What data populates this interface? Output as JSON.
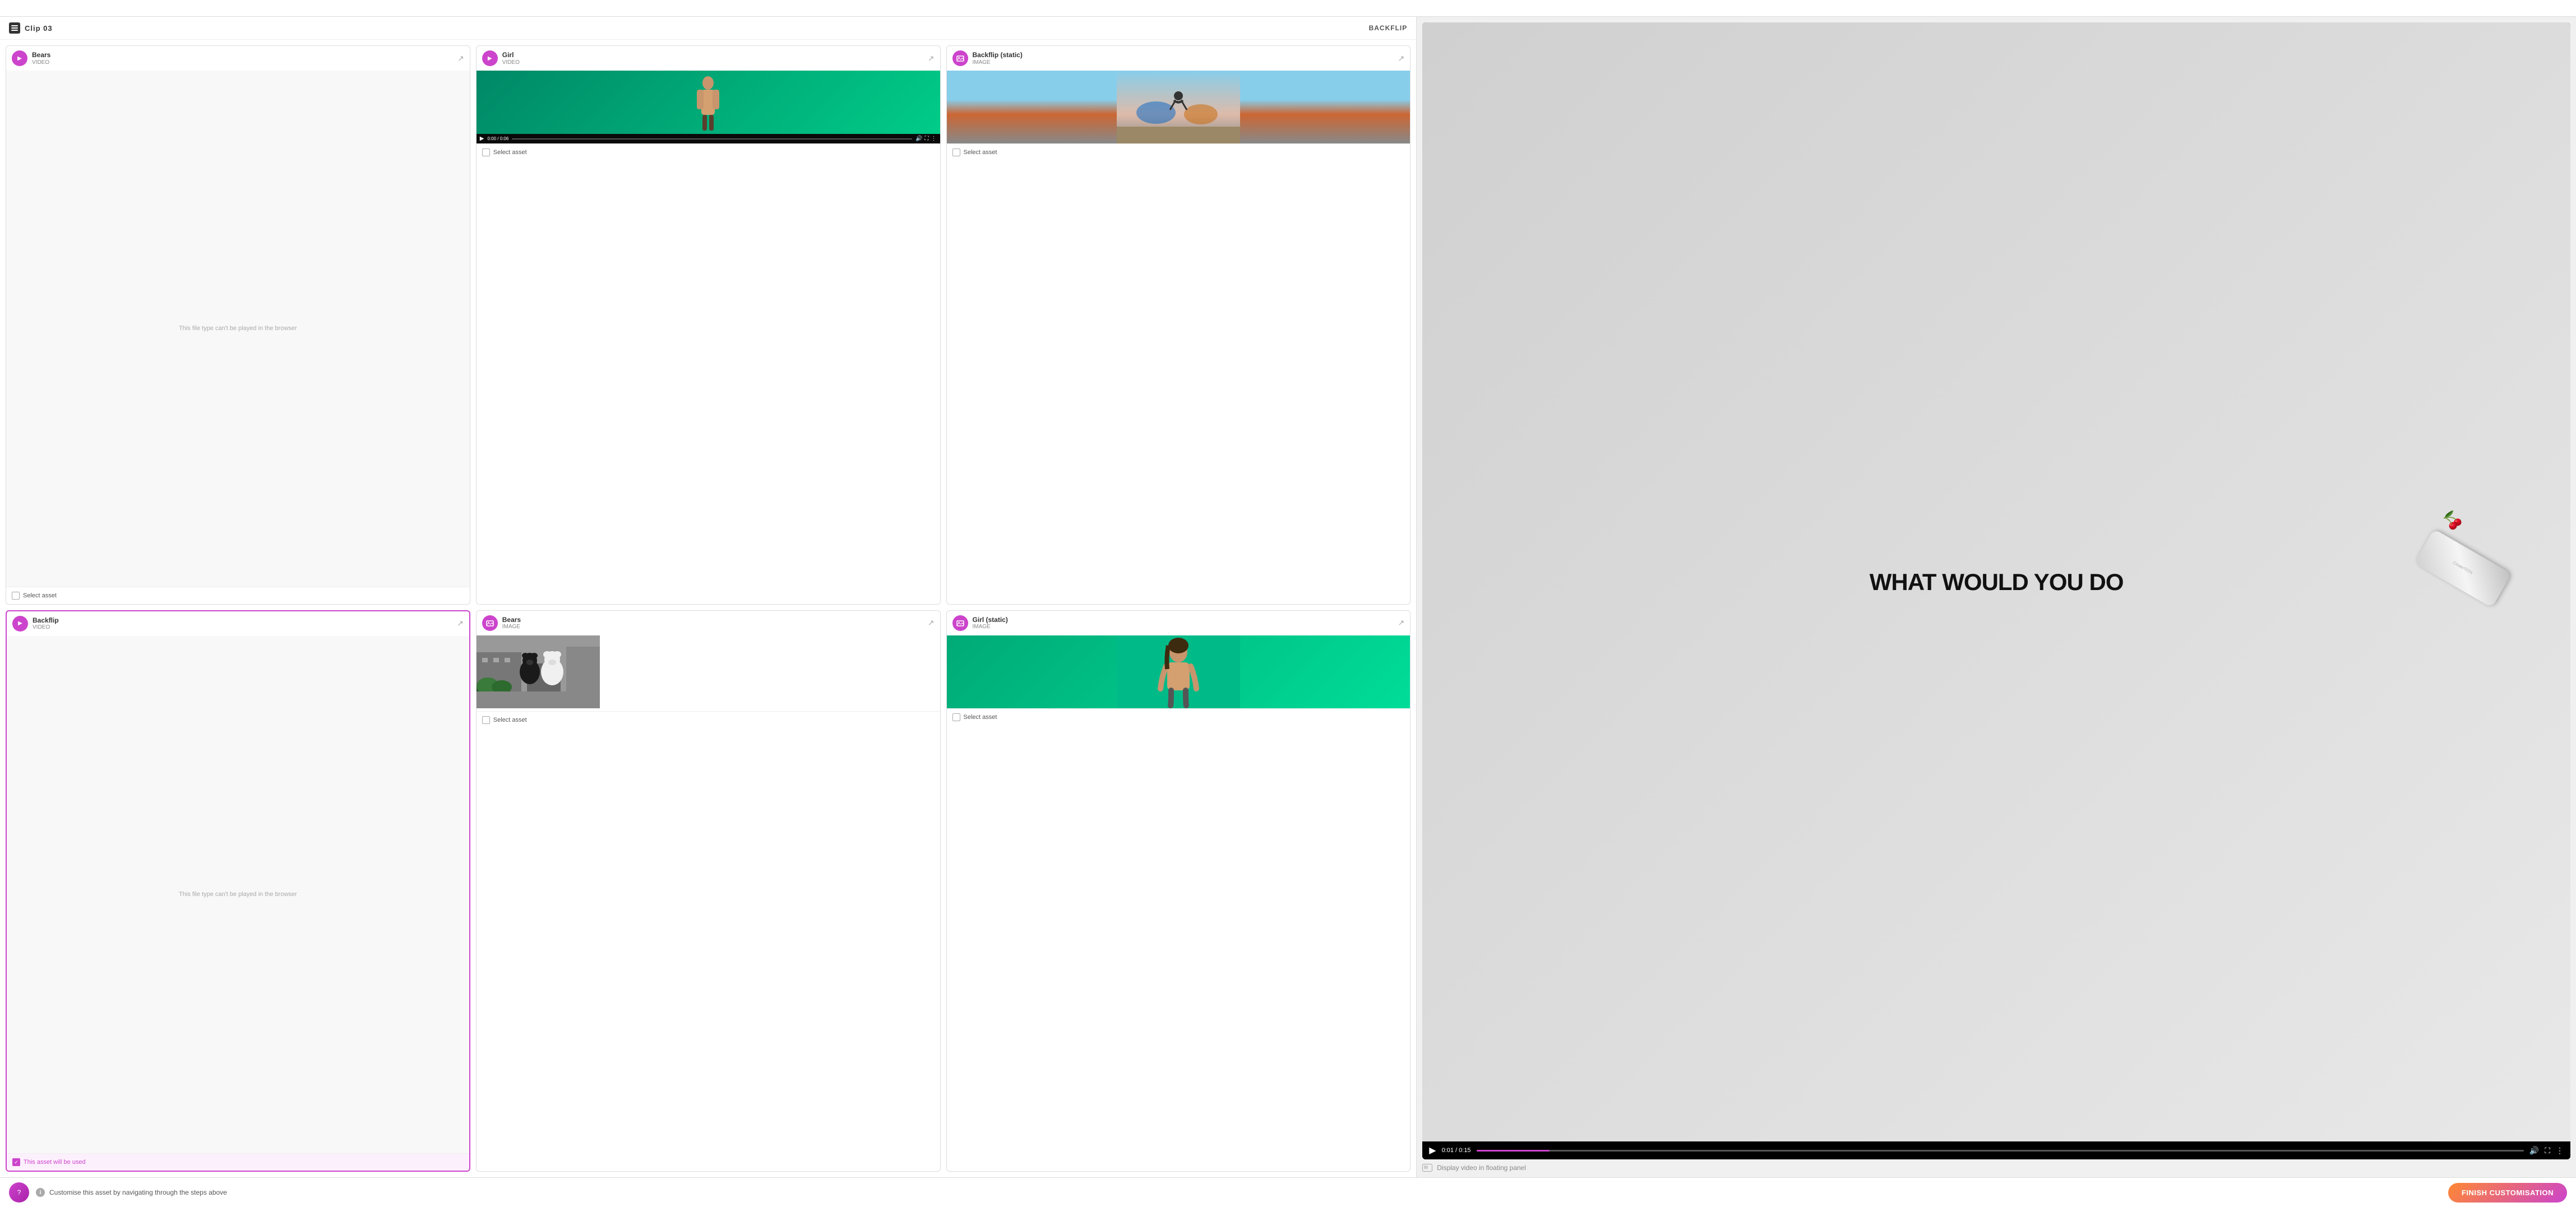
{
  "header": {
    "clip_icon": "▤",
    "clip_title": "Clip 03",
    "backflip_label": "BACKFLIP"
  },
  "assets": [
    {
      "id": "bears-video",
      "name": "Bears",
      "type": "VIDEO",
      "icon": "play",
      "selected": false,
      "footer_label": "Select asset",
      "preview": "no-play",
      "no_preview_text": "This file type can't be played in the browser"
    },
    {
      "id": "girl-video",
      "name": "Girl",
      "type": "VIDEO",
      "icon": "play",
      "selected": false,
      "footer_label": "Select asset",
      "preview": "girl-video",
      "video_time": "0:00 / 0:06"
    },
    {
      "id": "backflip-static",
      "name": "Backflip (static)",
      "type": "IMAGE",
      "icon": "image",
      "selected": false,
      "footer_label": "Select asset",
      "preview": "backflip-image"
    },
    {
      "id": "backflip-video",
      "name": "Backflip",
      "type": "VIDEO",
      "icon": "play",
      "selected": true,
      "footer_label": "This asset will be used",
      "preview": "no-play",
      "no_preview_text": "This file type can't be played in the browser"
    },
    {
      "id": "bears-image",
      "name": "Bears",
      "type": "IMAGE",
      "icon": "image",
      "selected": false,
      "footer_label": "Select asset",
      "preview": "bears-image"
    },
    {
      "id": "girl-static",
      "name": "Girl (static)",
      "type": "IMAGE",
      "icon": "image",
      "selected": false,
      "footer_label": "Select asset",
      "preview": "girl-static"
    }
  ],
  "video_player": {
    "main_text": "WHAT WOULD YOU DO",
    "can_label": "CreateTOTA",
    "cherry": "🍒",
    "time": "0:01 / 0:15",
    "progress_pct": 7
  },
  "floating_panel": {
    "label": "Display video in floating panel"
  },
  "bottom_bar": {
    "info_text": "Customise this asset by navigating through the steps above",
    "finish_btn": "FINISH CUSTOMISATION"
  }
}
